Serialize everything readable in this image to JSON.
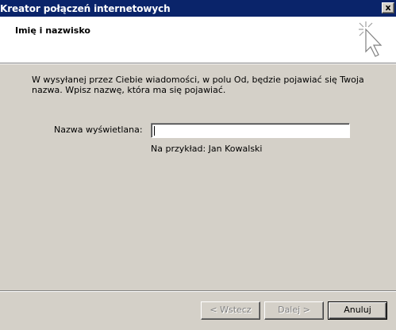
{
  "window": {
    "title": "Kreator połączeń internetowych",
    "close_symbol": "x"
  },
  "header": {
    "title": "Imię i nazwisko",
    "icon": "wizard-cursor-icon"
  },
  "main": {
    "description": "W wysyłanej przez Ciebie wiadomości, w polu Od, będzie pojawiać się Twoja nazwa. Wpisz nazwę, która ma się pojawiać.",
    "field_label": "Nazwa wyświetlana:",
    "field_value": "",
    "example": "Na przykład: Jan Kowalski"
  },
  "buttons": {
    "back": "< Wstecz",
    "next": "Dalej >",
    "cancel": "Anuluj"
  }
}
